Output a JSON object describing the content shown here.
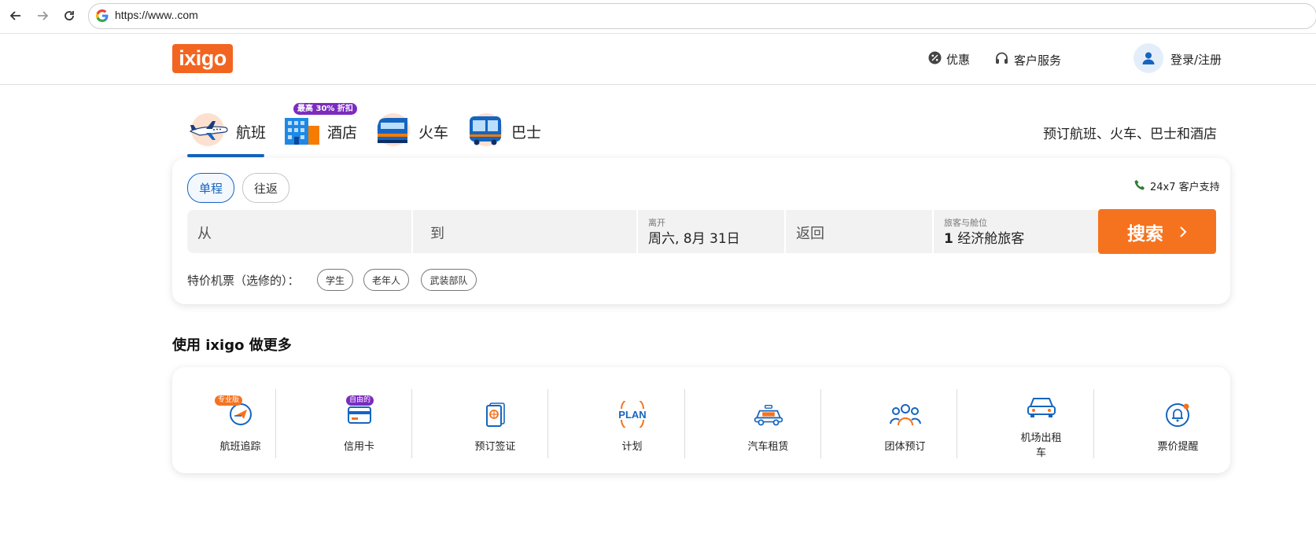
{
  "browser": {
    "url": "https://www..com"
  },
  "header": {
    "logo": "ixigo",
    "offers_label": "优惠",
    "service_label": "客户服务",
    "login_label": "登录/注册"
  },
  "tabs": [
    {
      "label": "航班",
      "active": true
    },
    {
      "label": "酒店",
      "badge": "最高 30% 折扣"
    },
    {
      "label": "火车"
    },
    {
      "label": "巴士"
    }
  ],
  "tagline": "预订航班、火车、巴士和酒店",
  "search": {
    "trip_types": [
      "单程",
      "往返"
    ],
    "support_label": "24x7 客户支持",
    "from_placeholder": "从",
    "to_placeholder": "到",
    "depart_label": "离开",
    "depart_value": "周六, 8月 31日",
    "return_placeholder": "返回",
    "pax_label": "旅客与舱位",
    "pax_count": "1",
    "pax_value": "经济舱旅客",
    "search_button": "搜索",
    "special_fares_label": "特价机票（选修的）：",
    "special_fares": [
      "学生",
      "老年人",
      "武装部队"
    ]
  },
  "more": {
    "title": "使用 ixigo 做更多",
    "features": [
      {
        "label": "航班追踪",
        "badge": "专业版",
        "badge_color": "#f5731f",
        "icon": "plane-tracker-icon"
      },
      {
        "label": "信用卡",
        "badge": "自由的",
        "badge_color": "#7b2cbf",
        "icon": "credit-card-icon"
      },
      {
        "label": "预订签证",
        "icon": "passport-icon"
      },
      {
        "label": "计划",
        "icon": "plan-icon",
        "icon_text": "PLAN"
      },
      {
        "label": "汽车租赁",
        "icon": "taxi-icon"
      },
      {
        "label": "团体预订",
        "icon": "group-icon"
      },
      {
        "label": "机场出租车",
        "icon": "airport-cab-icon"
      },
      {
        "label": "票价提醒",
        "icon": "fare-alert-icon"
      }
    ]
  },
  "colors": {
    "brand": "#f26521",
    "accent": "#1565c0",
    "search": "#f5731f"
  }
}
